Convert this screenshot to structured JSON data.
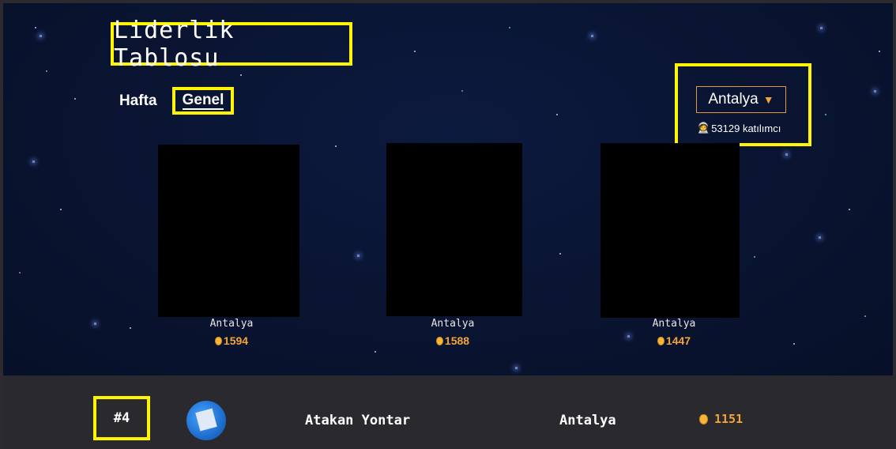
{
  "header": {
    "title": "Liderlik Tablosu"
  },
  "tabs": [
    {
      "label": "Hafta"
    },
    {
      "label": "Genel",
      "active": true
    }
  ],
  "city_filter": {
    "selected": "Antalya",
    "participants": "53129 katılımcı",
    "participants_icon": "astronaut-icon"
  },
  "podium": [
    {
      "city": "Antalya",
      "score": "1594"
    },
    {
      "city": "Antalya",
      "score": "1588"
    },
    {
      "city": "Antalya",
      "score": "1447"
    }
  ],
  "rows": [
    {
      "rank": "#4",
      "name": "Atakan Yontar",
      "city": "Antalya",
      "score": "1151"
    }
  ],
  "colors": {
    "highlight": "#fff500",
    "accent": "#f2a43a",
    "background": "#0a1533",
    "row_background": "#2a2a2e"
  }
}
